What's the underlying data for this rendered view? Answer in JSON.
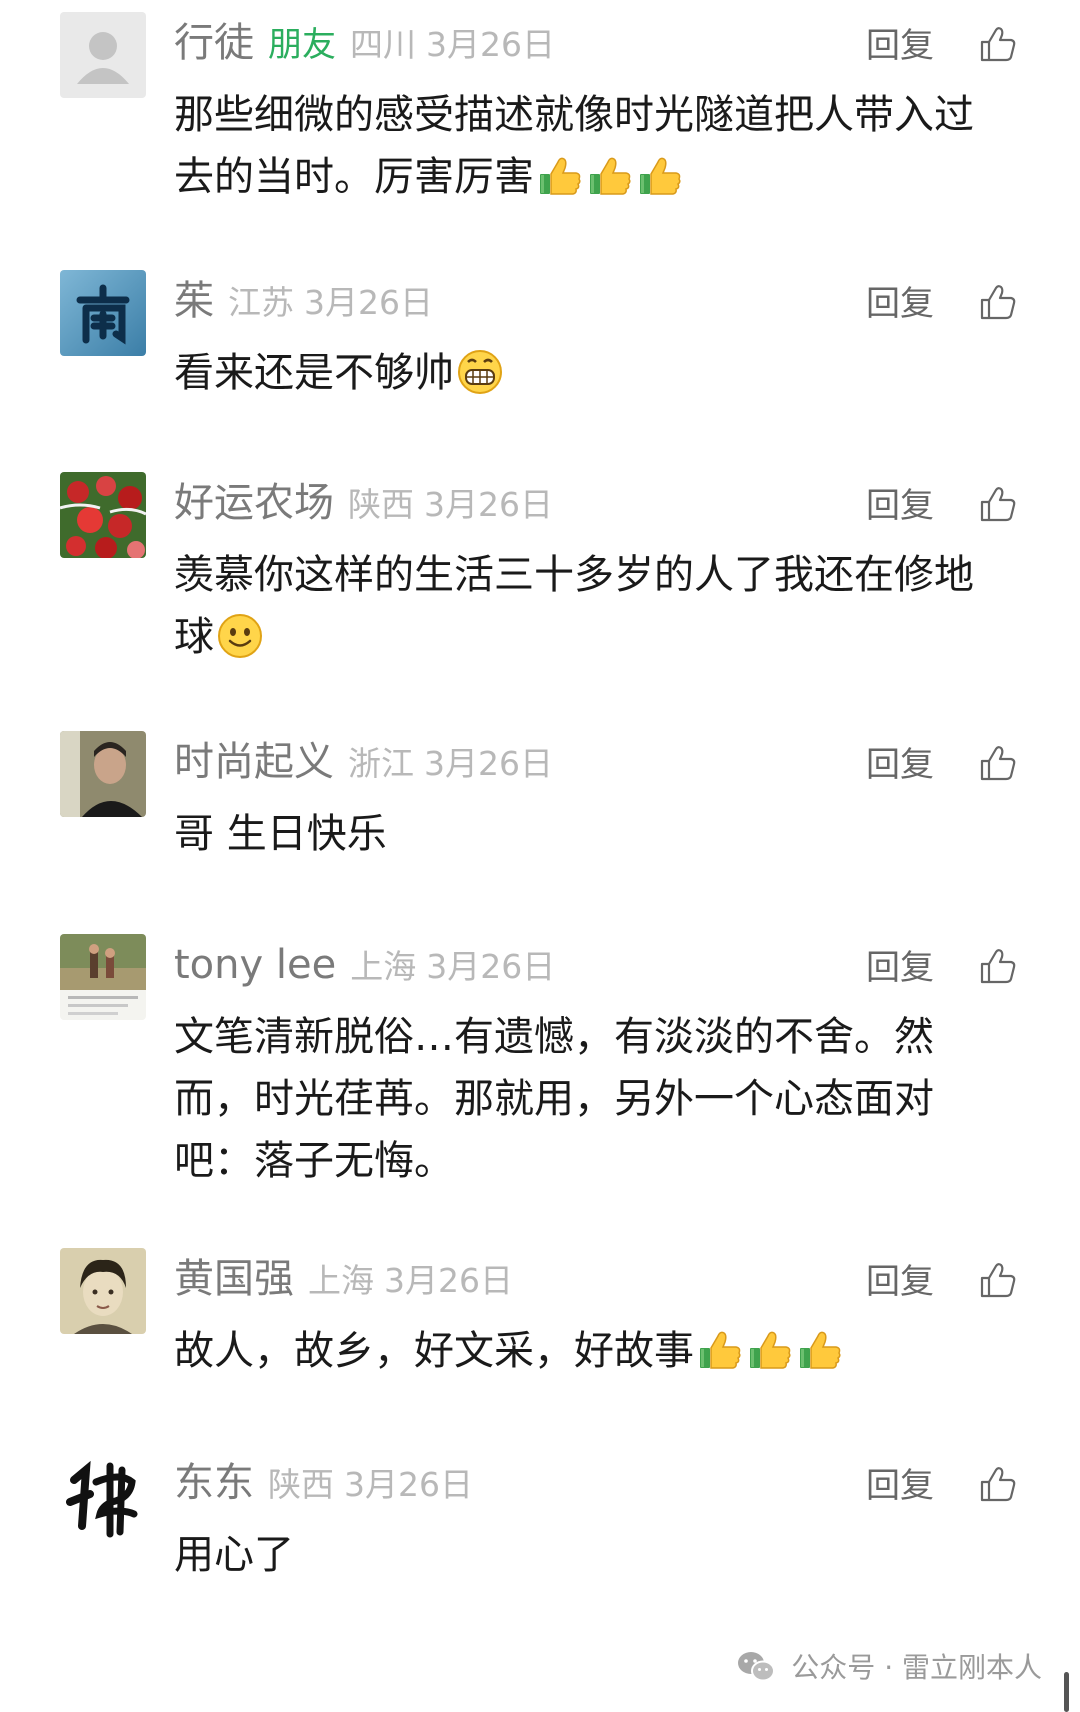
{
  "comments": [
    {
      "avatar_icon": "default-user-icon",
      "nickname": "行徒",
      "friend_tag": "朋友",
      "region": "四川",
      "date": "3月26日",
      "reply_label": "回复",
      "text": "那些细微的感受描述就像时光隧道把人带入过去的当时。厉害厉害",
      "emojis": [
        "thumbs-up",
        "thumbs-up",
        "thumbs-up"
      ]
    },
    {
      "avatar_icon": "nan-calligraphy-avatar",
      "nickname": "茱",
      "friend_tag": "",
      "region": "江苏",
      "date": "3月26日",
      "reply_label": "回复",
      "text": "看来还是不够帅",
      "emojis": [
        "grin"
      ]
    },
    {
      "avatar_icon": "apples-avatar",
      "nickname": "好运农场",
      "friend_tag": "",
      "region": "陕西",
      "date": "3月26日",
      "reply_label": "回复",
      "text": "羡慕你这样的生活三十多岁的人了我还在修地球",
      "emojis": [
        "smile"
      ]
    },
    {
      "avatar_icon": "person-photo-avatar",
      "nickname": "时尚起义",
      "friend_tag": "",
      "region": "浙江",
      "date": "3月26日",
      "reply_label": "回复",
      "text": "哥 生日快乐",
      "emojis": []
    },
    {
      "avatar_icon": "field-photo-avatar",
      "nickname": "tony lee",
      "friend_tag": "",
      "region": "上海",
      "date": "3月26日",
      "reply_label": "回复",
      "text": "文笔清新脱俗…有遗憾，有淡淡的不舍。然而，时光荏苒。那就用，另外一个心态面对吧：落子无悔。",
      "emojis": []
    },
    {
      "avatar_icon": "portrait-photo-avatar",
      "nickname": "黄国强",
      "friend_tag": "",
      "region": "上海",
      "date": "3月26日",
      "reply_label": "回复",
      "text": "故人，故乡，好文采，好故事",
      "emojis": [
        "thumbs-up",
        "thumbs-up",
        "thumbs-up"
      ]
    },
    {
      "avatar_icon": "fo-calligraphy-avatar",
      "nickname": "东东",
      "friend_tag": "",
      "region": "陕西",
      "date": "3月26日",
      "reply_label": "回复",
      "text": "用心了",
      "emojis": []
    }
  ],
  "watermark": {
    "icon": "wechat-icon",
    "text": "公众号 · 雷立刚本人"
  },
  "colors": {
    "nickname": "#7a7a7a",
    "friend_tag": "#2bae5e",
    "meta": "#b8b8b8",
    "text": "#1a1a1a"
  }
}
